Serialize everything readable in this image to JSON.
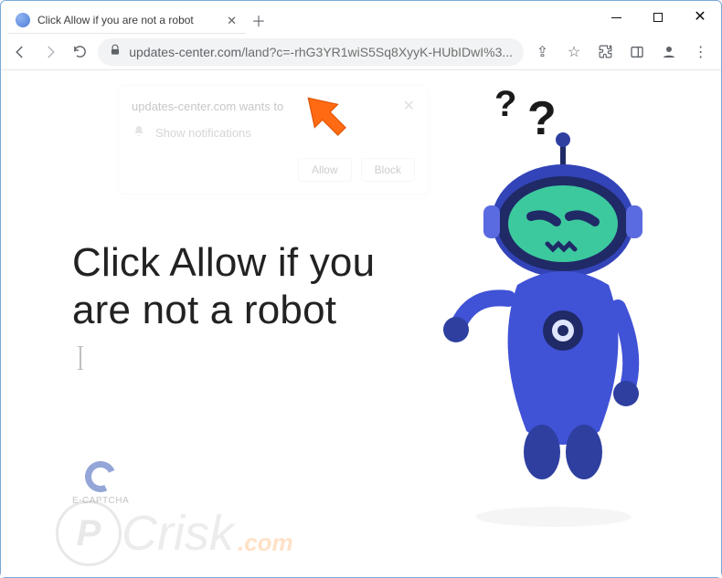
{
  "window": {
    "tab_title": "Click Allow if you are not a robot",
    "url_host": "updates-center.com",
    "url_path": "/land?c=-rhG3YR1wiS5Sq8XyyK-HUbIDwI%3..."
  },
  "toolbar": {
    "share_symbol": "⇪",
    "star_symbol": "☆",
    "ext_icon": "puzzle-icon",
    "panel_icon": "side-panel-icon",
    "profile_icon": "profile-avatar-icon",
    "menu_symbol": "⋮"
  },
  "permission": {
    "origin_wants": "updates-center.com wants to",
    "show_notifs": "Show notifications",
    "allow": "Allow",
    "block": "Block"
  },
  "page": {
    "headline": "Click Allow if you are not a robot",
    "ecaptcha_label": "E-CAPTCHA",
    "robot_q1": "?",
    "robot_q2": "?"
  },
  "watermark": {
    "p": "P",
    "text": "Crisk",
    "suffix": ".com"
  }
}
